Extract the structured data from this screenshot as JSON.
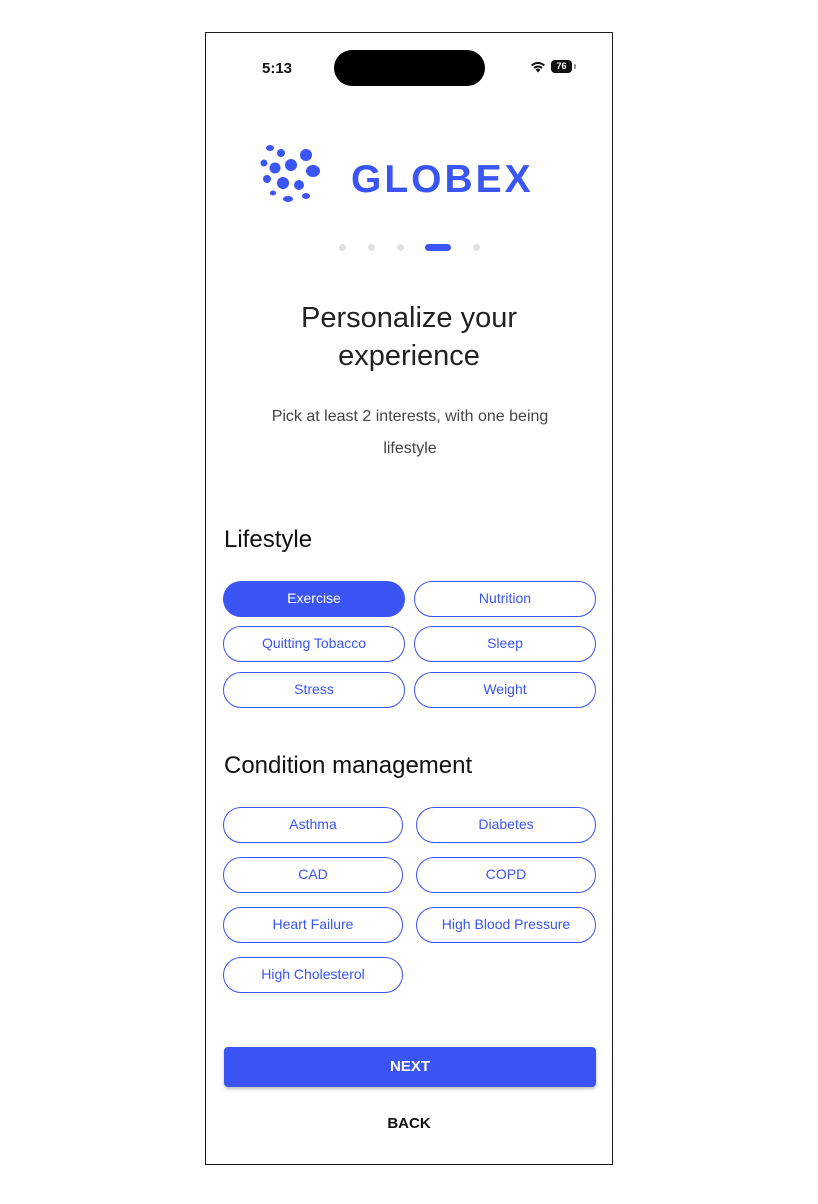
{
  "status_bar": {
    "time": "5:13",
    "battery_level": "76"
  },
  "brand": {
    "name": "GLOBEX",
    "color": "#3a55f4",
    "icon": "globex-dots-logo-icon"
  },
  "pagination": {
    "total_steps": 5,
    "current_step": 4
  },
  "heading": {
    "line1": "Personalize your",
    "line2": "experience"
  },
  "subtitle": {
    "line1": "Pick at least 2 interests, with one being",
    "line2": "lifestyle"
  },
  "lifestyle": {
    "title": "Lifestyle",
    "chips": [
      {
        "label": "Exercise",
        "selected": true
      },
      {
        "label": "Nutrition",
        "selected": false
      },
      {
        "label": "Quitting Tobacco",
        "selected": false
      },
      {
        "label": "Sleep",
        "selected": false
      },
      {
        "label": "Stress",
        "selected": false
      },
      {
        "label": "Weight",
        "selected": false
      }
    ]
  },
  "conditions": {
    "title": "Condition management",
    "chips": [
      {
        "label": "Asthma",
        "selected": false
      },
      {
        "label": "Diabetes",
        "selected": false
      },
      {
        "label": "CAD",
        "selected": false
      },
      {
        "label": "COPD",
        "selected": false
      },
      {
        "label": "Heart Failure",
        "selected": false
      },
      {
        "label": "High Blood Pressure",
        "selected": false
      },
      {
        "label": "High Cholesterol",
        "selected": false
      }
    ]
  },
  "actions": {
    "next_label": "NEXT",
    "back_label": "BACK"
  }
}
